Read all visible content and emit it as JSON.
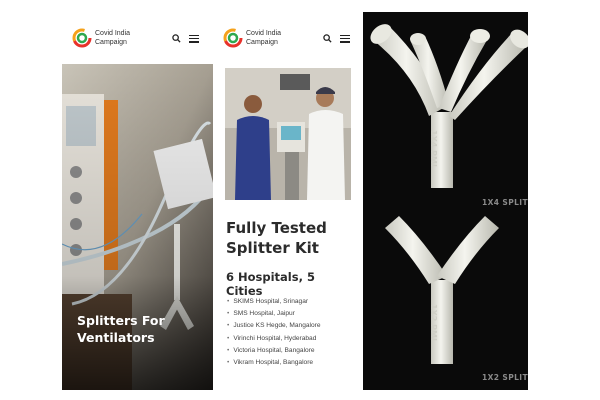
{
  "logo": {
    "line1": "Covid India",
    "line2": "Campaign",
    "colors": {
      "red": "#e8322b",
      "orange": "#f5a21b",
      "green": "#2fa84f"
    }
  },
  "icons": {
    "search": "search-icon",
    "menu": "hamburger-menu-icon"
  },
  "panel1": {
    "hero_title_line1": "Splitters For",
    "hero_title_line2": "Ventilators"
  },
  "panel2": {
    "title_line1": "Fully Tested",
    "title_line2": "Splitter Kit",
    "subtitle": "6 Hospitals, 5 Cities",
    "hospitals": [
      "SKIMS Hospital, Srinagar",
      "SMS Hospital, Jaipur",
      "Justice KS Hegde, Mangalore",
      "Virinchi Hospital, Hyderabad",
      "Victoria Hospital, Bangalore",
      "Vikram Hospital, Bangalore"
    ]
  },
  "panel3": {
    "label_top": "1X4 SPLIT",
    "label_bottom": "1X2 SPLIT",
    "emboss_top": "1X4 PMI",
    "emboss_bottom": "1X2 PMI"
  }
}
